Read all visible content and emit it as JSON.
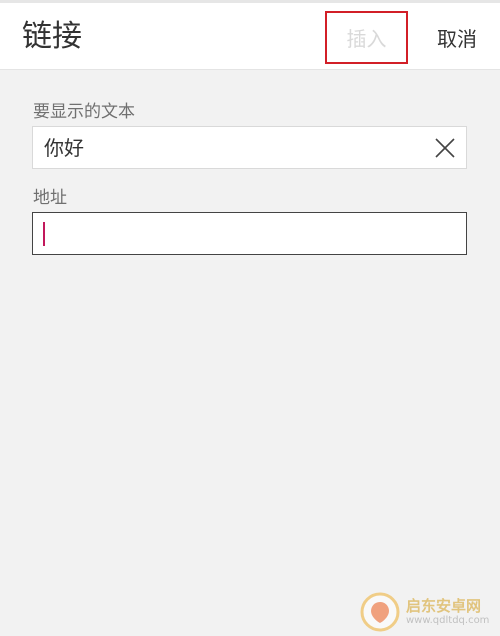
{
  "header": {
    "title": "链接",
    "insert_label": "插入",
    "cancel_label": "取消"
  },
  "form": {
    "display_text_label": "要显示的文本",
    "display_text_value": "你好",
    "address_label": "地址",
    "address_value": ""
  },
  "watermark": {
    "name": "启东安卓网",
    "url": "www.qdltdq.com"
  },
  "colors": {
    "accent_red": "#d21f27",
    "caret": "#c2185b",
    "background": "#f2f2f2"
  },
  "icons": {
    "clear": "close-icon",
    "watermark_logo": "logo-icon"
  }
}
